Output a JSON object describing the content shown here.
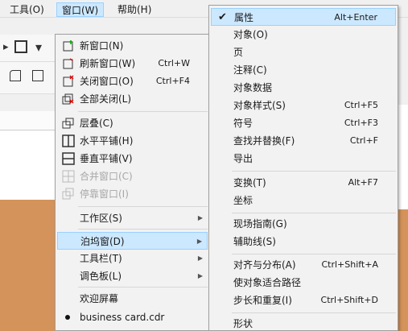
{
  "menubar": {
    "tools": "工具(O)",
    "window": "窗口(W)",
    "help": "帮助(H)"
  },
  "window_menu": {
    "items": [
      {
        "label": "新窗口(N)",
        "shortcut": "",
        "disabled": false
      },
      {
        "label": "刷新窗口(W)",
        "shortcut": "Ctrl+W",
        "disabled": false
      },
      {
        "label": "关闭窗口(O)",
        "shortcut": "Ctrl+F4",
        "disabled": false
      },
      {
        "label": "全部关闭(L)",
        "shortcut": "",
        "disabled": false
      },
      {
        "label": "层叠(C)",
        "shortcut": "",
        "disabled": false
      },
      {
        "label": "水平平铺(H)",
        "shortcut": "",
        "disabled": false
      },
      {
        "label": "垂直平铺(V)",
        "shortcut": "",
        "disabled": false
      },
      {
        "label": "合并窗口(C)",
        "shortcut": "",
        "disabled": true
      },
      {
        "label": "停靠窗口(I)",
        "shortcut": "",
        "disabled": true
      },
      {
        "label": "工作区(S)",
        "submenu": true
      },
      {
        "label": "泊坞窗(D)",
        "submenu": true,
        "highlight": true
      },
      {
        "label": "工具栏(T)",
        "submenu": true
      },
      {
        "label": "调色板(L)",
        "submenu": true
      },
      {
        "label": "欢迎屏幕"
      },
      {
        "label": "business card.cdr",
        "bullet": true
      }
    ]
  },
  "docker_menu": {
    "items": [
      {
        "label": "属性",
        "shortcut": "Alt+Enter",
        "checked": true
      },
      {
        "label": "对象(O)",
        "shortcut": ""
      },
      {
        "label": "页",
        "shortcut": ""
      },
      {
        "label": "注释(C)",
        "shortcut": ""
      },
      {
        "label": "对象数据",
        "shortcut": ""
      },
      {
        "label": "对象样式(S)",
        "shortcut": "Ctrl+F5"
      },
      {
        "label": "符号",
        "shortcut": "Ctrl+F3"
      },
      {
        "label": "查找并替换(F)",
        "shortcut": "Ctrl+F"
      },
      {
        "label": "导出",
        "shortcut": ""
      },
      {
        "label": "变换(T)",
        "shortcut": "Alt+F7"
      },
      {
        "label": "坐标",
        "shortcut": ""
      },
      {
        "label": "现场指南(G)",
        "shortcut": ""
      },
      {
        "label": "辅助线(S)",
        "shortcut": ""
      },
      {
        "label": "对齐与分布(A)",
        "shortcut": "Ctrl+Shift+A"
      },
      {
        "label": "使对象适合路径",
        "shortcut": ""
      },
      {
        "label": "步长和重复(I)",
        "shortcut": "Ctrl+Shift+D"
      },
      {
        "label": "形状",
        "shortcut": ""
      }
    ]
  }
}
